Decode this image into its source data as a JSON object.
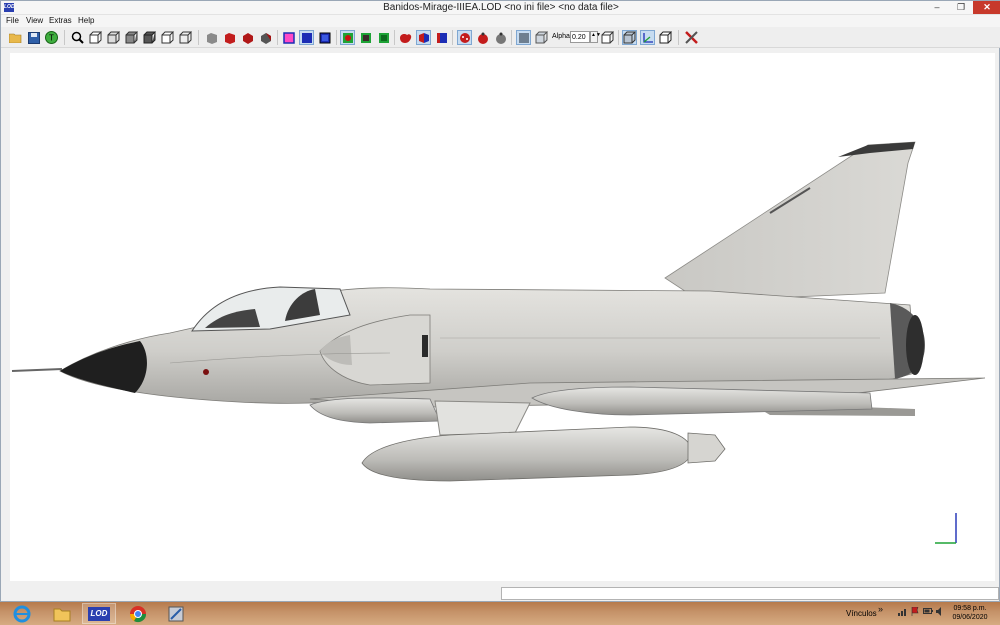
{
  "window": {
    "title": "Banidos-Mirage-IIIEA.LOD  <no ini file>  <no data file>",
    "app_icon_text": "LOD",
    "minimize_glyph": "–",
    "maximize_glyph": "❐",
    "close_glyph": "✕"
  },
  "menu": [
    "File",
    "View",
    "Extras",
    "Help"
  ],
  "toolbar": {
    "alpha_label": "Alpha:",
    "alpha_value": "0.20",
    "spin_glyph": "▲▼"
  },
  "taskbar": {
    "tray_label": "Vínculos",
    "tray_expand": "»",
    "clock_time": "09:58 p.m.",
    "clock_date": "09/06/2020"
  },
  "colors": {
    "accent": "#3a78c8",
    "close_button": "#c7392b",
    "viewport": "#ffffff"
  }
}
